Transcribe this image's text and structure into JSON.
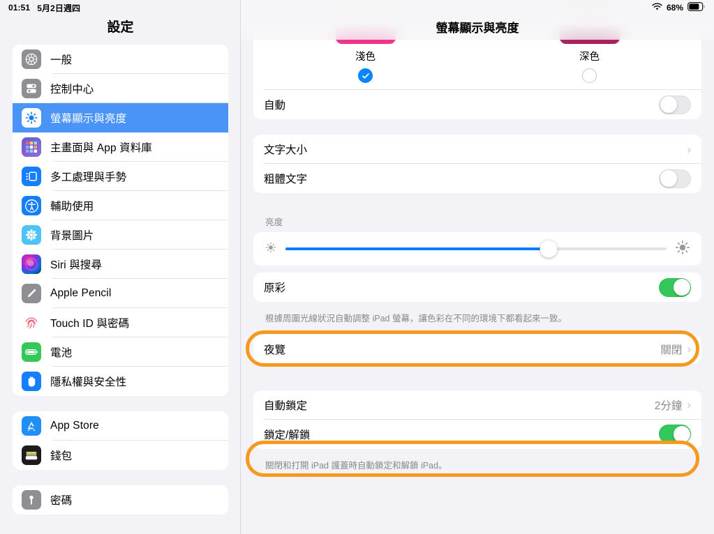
{
  "status_bar": {
    "time": "01:51",
    "date": "5月2日週四",
    "wifi_icon": "wifi-icon",
    "battery_percent": "68%",
    "battery_icon": "battery-icon"
  },
  "sidebar": {
    "title": "設定",
    "selected_color": "#4a93f7",
    "groups": [
      {
        "items": [
          {
            "label": "一般",
            "icon": "gear-icon",
            "selected": false
          },
          {
            "label": "控制中心",
            "icon": "control-center-icon",
            "selected": false
          },
          {
            "label": "螢幕顯示與亮度",
            "icon": "brightness-sun-icon",
            "selected": true
          },
          {
            "label": "主畫面與 App 資料庫",
            "icon": "app-library-icon",
            "selected": false
          },
          {
            "label": "多工處理與手勢",
            "icon": "multitasking-icon",
            "selected": false
          },
          {
            "label": "輔助使用",
            "icon": "accessibility-icon",
            "selected": false
          },
          {
            "label": "背景圖片",
            "icon": "wallpaper-icon",
            "selected": false
          },
          {
            "label": "Siri 與搜尋",
            "icon": "siri-icon",
            "selected": false
          },
          {
            "label": "Apple Pencil",
            "icon": "pencil-icon",
            "selected": false
          },
          {
            "label": "Touch ID 與密碼",
            "icon": "fingerprint-icon",
            "selected": false
          },
          {
            "label": "電池",
            "icon": "battery-settings-icon",
            "selected": false
          },
          {
            "label": "隱私權與安全性",
            "icon": "privacy-hand-icon",
            "selected": false
          }
        ]
      },
      {
        "items": [
          {
            "label": "App Store",
            "icon": "app-store-icon",
            "selected": false
          },
          {
            "label": "錢包",
            "icon": "wallet-icon",
            "selected": false
          }
        ]
      },
      {
        "items": [
          {
            "label": "密碼",
            "icon": "passwords-key-icon",
            "selected": false
          }
        ]
      }
    ]
  },
  "main": {
    "title": "螢幕顯示與亮度",
    "appearance": {
      "options": [
        {
          "label": "淺色",
          "selected": true
        },
        {
          "label": "深色",
          "selected": false
        }
      ],
      "auto_row": {
        "label": "自動",
        "toggle": "off"
      }
    },
    "text_group": [
      {
        "label": "文字大小",
        "type": "chevron",
        "value": ""
      },
      {
        "label": "粗體文字",
        "type": "toggle",
        "toggle": "off"
      }
    ],
    "brightness": {
      "section_label": "亮度",
      "low_icon": "sun-small-icon",
      "high_icon": "sun-large-icon",
      "value_percent": 69
    },
    "true_tone": {
      "label": "原彩",
      "toggle": "on",
      "footnote": "根據周圍光線狀況自動調整 iPad 螢幕，讓色彩在不同的環境下都看起來一致。",
      "highlighted": true
    },
    "night_shift": {
      "label": "夜覽",
      "value": "關閉",
      "type": "chevron"
    },
    "lock_group": {
      "rows": [
        {
          "label": "自動鎖定",
          "value": "2分鐘",
          "type": "chevron",
          "highlighted": true
        },
        {
          "label": "鎖定/解鎖",
          "type": "toggle",
          "toggle": "on",
          "highlighted": false
        }
      ],
      "footnote": "關閉和打開 iPad 護蓋時自動鎖定和解鎖 iPad。"
    }
  },
  "annotations": {
    "color": "#f59a1e",
    "rings": [
      "true-tone-row",
      "auto-lock-row"
    ]
  }
}
